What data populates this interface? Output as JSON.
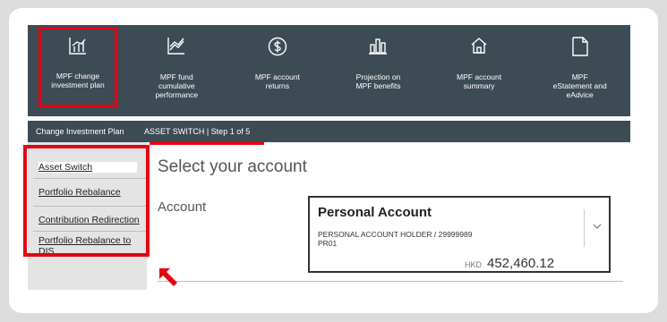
{
  "nav": [
    {
      "label": "MPF change\ninvestment plan",
      "icon": "bar-chart-icon",
      "selected": true
    },
    {
      "label": "MPF fund\ncumulative\nperformance",
      "icon": "line-chart-icon",
      "selected": false
    },
    {
      "label": "MPF account\nreturns",
      "icon": "dollar-icon",
      "selected": false
    },
    {
      "label": "Projection on\nMPF benefits",
      "icon": "column-chart-icon",
      "selected": false
    },
    {
      "label": "MPF account\nsummary",
      "icon": "home-icon",
      "selected": false
    },
    {
      "label": "MPF\neStatement and\neAdvice",
      "icon": "document-icon",
      "selected": false
    }
  ],
  "breadcrumb": {
    "root": "Change Investment Plan",
    "step": "ASSET SWITCH | Step 1 of 5"
  },
  "sidebar": {
    "items": [
      {
        "label": "Asset Switch"
      },
      {
        "label": "Portfolio Rebalance"
      },
      {
        "label": "Contribution Redirection"
      },
      {
        "label": "Portfolio Rebalance to DIS"
      }
    ]
  },
  "main": {
    "title": "Select your account",
    "account_label": "Account"
  },
  "account": {
    "name": "Personal Account",
    "holder": "PERSONAL ACCOUNT HOLDER / 29999989",
    "code": "PR01",
    "currency": "HKD",
    "amount": "452,460.12"
  },
  "colors": {
    "nav_bg": "#3d4b55",
    "highlight": "#e30613",
    "sidebar_bg": "#e4e4e4"
  }
}
